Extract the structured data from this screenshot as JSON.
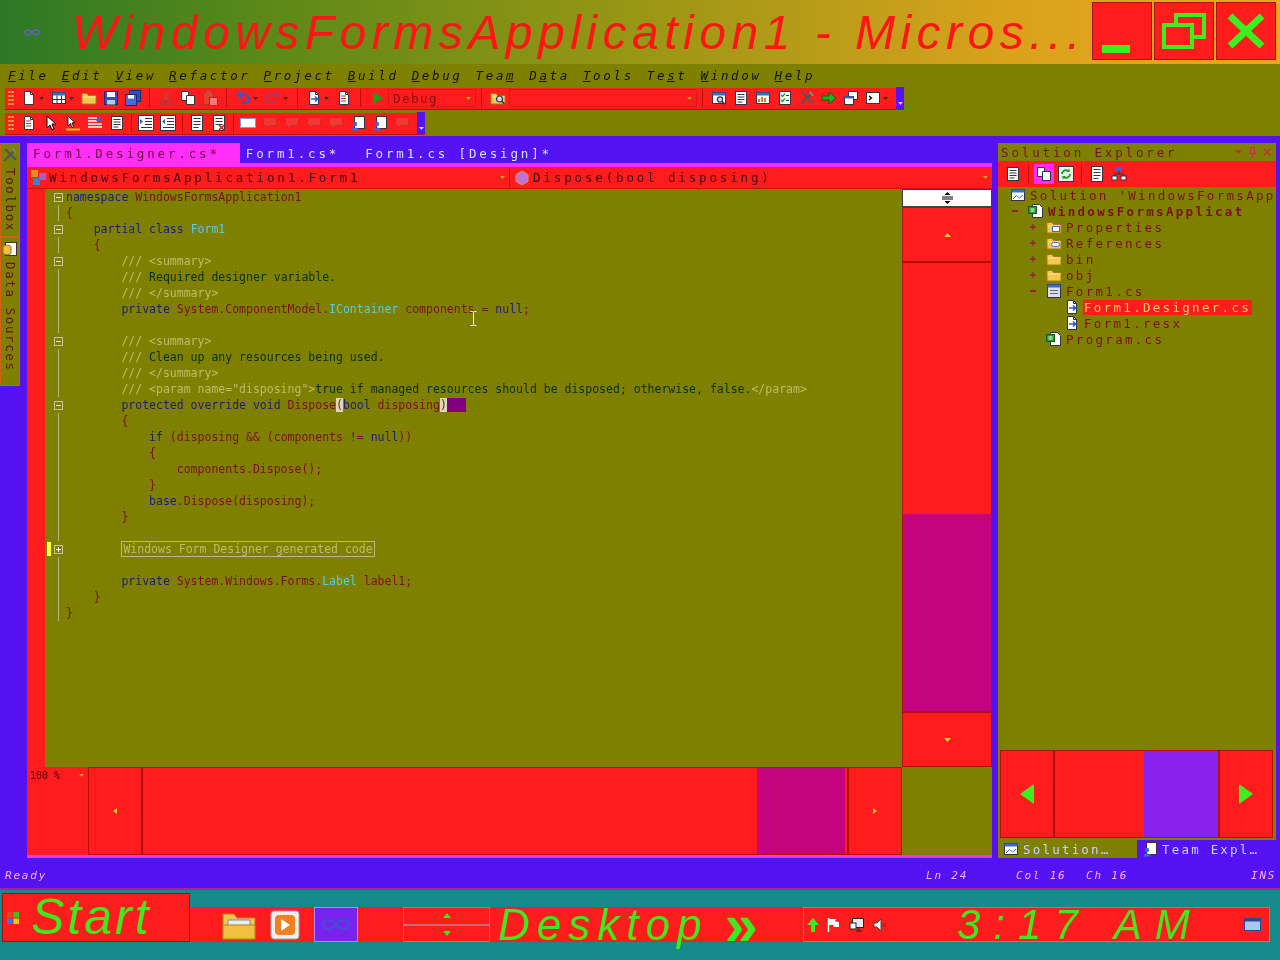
{
  "window": {
    "title": "WindowsFormsApplication1 - Micros..."
  },
  "menu": [
    {
      "access_key": "F",
      "after": "ile"
    },
    {
      "access_key": "E",
      "after": "dit"
    },
    {
      "access_key": "V",
      "after": "iew"
    },
    {
      "access_key": "R",
      "after": "efactor"
    },
    {
      "access_key": "P",
      "after": "roject"
    },
    {
      "access_key": "B",
      "after": "uild"
    },
    {
      "access_key": "D",
      "after": "ebug"
    },
    {
      "before": "Tea",
      "access_key": "m"
    },
    {
      "before": "D",
      "access_key": "a",
      "after": "ta"
    },
    {
      "access_key": "T",
      "after": "ools"
    },
    {
      "before": "Te",
      "access_key": "s",
      "after": "t"
    },
    {
      "access_key": "W",
      "after": "indow"
    },
    {
      "access_key": "H",
      "after": "elp"
    }
  ],
  "toolbars": [
    {
      "buttons": [
        {
          "disabled": false
        },
        {
          "disabled": false
        },
        {
          "disabled": false
        },
        {
          "disabled": false
        },
        {
          "disabled": false
        },
        {
          "disabled": true
        },
        {
          "disabled": false
        },
        {
          "disabled": true
        },
        {
          "disabled": false
        },
        {
          "disabled": true
        },
        {
          "disabled": false
        },
        {
          "disabled": false
        },
        {
          "disabled": false
        },
        {
          "disabled": false
        },
        {
          "disabled": false
        },
        {
          "disabled": false
        },
        {
          "disabled": false
        },
        {
          "disabled": false
        },
        {
          "disabled": false
        },
        {
          "disabled": false
        },
        {
          "disabled": false
        },
        {
          "disabled": false
        }
      ],
      "configuration": "Debug"
    },
    {
      "buttons": [
        {
          "disabled": false
        },
        {
          "disabled": false
        },
        {
          "disabled": false
        },
        {
          "disabled": false
        },
        {
          "disabled": false
        },
        {
          "disabled": false
        },
        {
          "disabled": false
        },
        {
          "disabled": false
        },
        {
          "disabled": false
        },
        {
          "disabled": false
        },
        {
          "disabled": true
        },
        {
          "disabled": true
        },
        {
          "disabled": true
        },
        {
          "disabled": true
        },
        {
          "disabled": false
        },
        {
          "disabled": false
        },
        {
          "disabled": true
        }
      ]
    }
  ],
  "side_tabs": [
    {
      "label": "Toolbox"
    },
    {
      "label": "Data Sources"
    }
  ],
  "editor": {
    "tabs": [
      {
        "label": "Form1.Designer.cs*",
        "selected": true
      },
      {
        "label": "Form1.cs*",
        "selected": false
      },
      {
        "label": "Form1.cs [Design]*",
        "selected": false
      }
    ],
    "type_combo": "WindowsFormsApplication1.Form1",
    "member_combo": "Dispose(bool disposing)",
    "zoom": "100 %",
    "lines": [
      {
        "changed": false,
        "expanded": true,
        "tokens": [
          {
            "kind": "keyword",
            "text": "namespace "
          },
          {
            "kind": "identifier",
            "text": "WindowsFormsApplication1"
          }
        ]
      },
      {
        "changed": false,
        "tokens": [
          {
            "kind": "identifier",
            "text": "{"
          }
        ],
        "children": [
          {
            "changed": false,
            "expanded": true,
            "tokens": [
              {
                "kind": "keyword",
                "text": "partial class "
              },
              {
                "kind": "type",
                "text": "Form1"
              }
            ]
          },
          {
            "changed": false,
            "tokens": [
              {
                "kind": "identifier",
                "text": "{"
              }
            ],
            "children": [
              {
                "changed": false,
                "expanded": true,
                "tokens": [
                  {
                    "kind": "doc",
                    "text": "/// <summary>"
                  }
                ]
              },
              {
                "changed": false,
                "tokens": [
                  {
                    "kind": "doc",
                    "text": "/// "
                  },
                  {
                    "kind": "comment",
                    "text": "Required designer variable."
                  }
                ]
              },
              {
                "changed": false,
                "tokens": [
                  {
                    "kind": "doc",
                    "text": "/// </summary>"
                  }
                ]
              },
              {
                "changed": false,
                "tokens": [
                  {
                    "kind": "keyword",
                    "text": "private "
                  },
                  {
                    "kind": "identifier",
                    "text": "System.ComponentModel."
                  },
                  {
                    "kind": "type",
                    "text": "IContainer"
                  },
                  {
                    "kind": "identifier",
                    "text": " components = "
                  },
                  {
                    "kind": "keyword",
                    "text": "null"
                  },
                  {
                    "kind": "identifier",
                    "text": ";"
                  }
                ]
              },
              {
                "changed": false
              },
              {
                "changed": false,
                "expanded": true,
                "tokens": [
                  {
                    "kind": "doc",
                    "text": "/// <summary>"
                  }
                ]
              },
              {
                "changed": false,
                "tokens": [
                  {
                    "kind": "doc",
                    "text": "/// "
                  },
                  {
                    "kind": "comment",
                    "text": "Clean up any resources being used."
                  }
                ]
              },
              {
                "changed": false,
                "tokens": [
                  {
                    "kind": "doc",
                    "text": "/// </summary>"
                  }
                ]
              },
              {
                "changed": false,
                "tokens": [
                  {
                    "kind": "doc",
                    "text": "/// <param name=\"disposing\">"
                  },
                  {
                    "kind": "comment",
                    "text": "true if managed resources should be disposed; otherwise, false."
                  },
                  {
                    "kind": "doc",
                    "text": "</param>"
                  }
                ]
              },
              {
                "changed": false,
                "expanded": true,
                "tokens": [
                  {
                    "kind": "keyword",
                    "text": "protected override void "
                  },
                  {
                    "kind": "identifier",
                    "text": "Dispose"
                  },
                  {
                    "kind": "brace",
                    "text": "("
                  },
                  {
                    "kind": "keyword",
                    "text": "bool"
                  },
                  {
                    "kind": "identifier",
                    "text": " disposing"
                  },
                  {
                    "kind": "brace",
                    "text": ")"
                  },
                  {
                    "kind": "selection"
                  }
                ]
              },
              {
                "changed": false,
                "tokens": [
                  {
                    "kind": "identifier",
                    "text": "{"
                  }
                ],
                "children": [
                  {
                    "changed": false,
                    "tokens": [
                      {
                        "kind": "keyword",
                        "text": "if "
                      },
                      {
                        "kind": "identifier",
                        "text": "(disposing && (components != "
                      },
                      {
                        "kind": "keyword",
                        "text": "null"
                      },
                      {
                        "kind": "identifier",
                        "text": "))"
                      }
                    ]
                  },
                  {
                    "changed": false,
                    "tokens": [
                      {
                        "kind": "identifier",
                        "text": "{"
                      }
                    ],
                    "children": [
                      {
                        "changed": false,
                        "tokens": [
                          {
                            "kind": "identifier",
                            "text": "components.Dispose();"
                          }
                        ]
                      }
                    ]
                  },
                  {
                    "changed": false,
                    "tokens": [
                      {
                        "kind": "identifier",
                        "text": "}"
                      }
                    ]
                  },
                  {
                    "changed": false,
                    "tokens": [
                      {
                        "kind": "keyword",
                        "text": "base"
                      },
                      {
                        "kind": "identifier",
                        "text": ".Dispose(disposing);"
                      }
                    ]
                  }
                ]
              },
              {
                "changed": false,
                "tokens": [
                  {
                    "kind": "identifier",
                    "text": "}"
                  }
                ]
              },
              {
                "changed": false
              },
              {
                "changed": true,
                "expanded": false,
                "tokens": [
                  {
                    "kind": "region",
                    "text": "Windows Form Designer generated code"
                  }
                ]
              },
              {
                "changed": false
              },
              {
                "changed": false,
                "tokens": [
                  {
                    "kind": "keyword",
                    "text": "private "
                  },
                  {
                    "kind": "identifier",
                    "text": "System.Windows.Forms."
                  },
                  {
                    "kind": "type",
                    "text": "Label"
                  },
                  {
                    "kind": "identifier",
                    "text": " label1;"
                  }
                ]
              }
            ]
          },
          {
            "changed": false,
            "tokens": [
              {
                "kind": "identifier",
                "text": "}"
              }
            ]
          }
        ]
      },
      {
        "changed": false,
        "tokens": [
          {
            "kind": "identifier",
            "text": "}"
          }
        ]
      }
    ]
  },
  "solution_explorer": {
    "title": "Solution Explorer",
    "buttons": [
      {
        "pressed": false
      },
      {
        "pressed": true
      },
      {
        "pressed": false
      },
      {
        "pressed": false
      },
      {
        "pressed": false
      }
    ],
    "tree": [
      {
        "label": "Solution 'WindowsFormsApp",
        "kind": "solution",
        "selected": false,
        "children": [
          {
            "label": "WindowsFormsApplicat",
            "kind": "project",
            "expanded": true,
            "selected": false,
            "children": [
              {
                "label": "Properties",
                "kind": "properties",
                "expanded": false,
                "selected": false
              },
              {
                "label": "References",
                "kind": "references",
                "expanded": false,
                "selected": false
              },
              {
                "label": "bin",
                "kind": "folder",
                "expanded": false,
                "selected": false
              },
              {
                "label": "obj",
                "kind": "folder",
                "expanded": false,
                "selected": false
              },
              {
                "label": "Form1.cs",
                "kind": "form",
                "expanded": true,
                "selected": false,
                "children": [
                  {
                    "label": "Form1.Designer.cs",
                    "kind": "dependent_file",
                    "selected": true
                  },
                  {
                    "label": "Form1.resx",
                    "kind": "dependent_file",
                    "selected": false
                  }
                ]
              },
              {
                "label": "Program.cs",
                "kind": "csharp",
                "selected": false
              }
            ]
          }
        ]
      }
    ],
    "tabs": [
      {
        "label": "Solution…",
        "selected": true
      },
      {
        "label": "Team Expl…",
        "selected": false
      }
    ]
  },
  "status_bar": {
    "message": "Ready",
    "line": "Ln 24",
    "column": "Col 16",
    "char": "Ch 16",
    "mode": "INS"
  },
  "taskbar": {
    "start": "Start",
    "quick_launch": [
      {
        "highlighted": false
      },
      {
        "highlighted": false
      },
      {
        "highlighted": true
      }
    ],
    "toolbar_label": "Desktop",
    "chevron": "»",
    "clock": "3:17 AM"
  }
}
